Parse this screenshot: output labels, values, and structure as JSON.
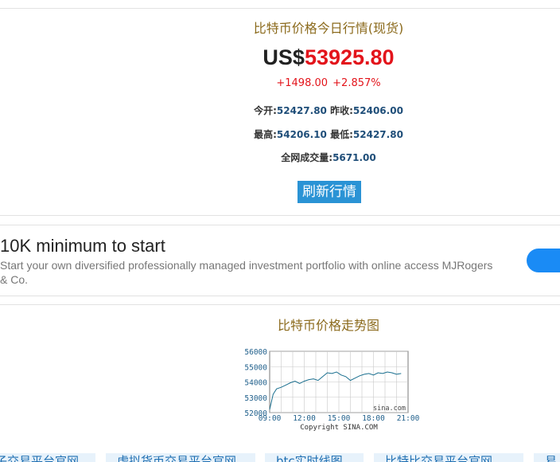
{
  "header": {
    "title": "比特币价格今日行情(现货)"
  },
  "price": {
    "currency": "US$",
    "value": "53925.80",
    "change": "+1498.00",
    "change_pct": "+2.857%"
  },
  "stats": {
    "open_label": "今开:",
    "open_value": "52427.80",
    "prev_close_label": "昨收:",
    "prev_close_value": "52406.00",
    "high_label": "最高:",
    "high_value": "54206.10",
    "low_label": "最低:",
    "low_value": "52427.80",
    "volume_label": "全网成交量:",
    "volume_value": "5671.00"
  },
  "refresh_button": "刷新行情",
  "ad": {
    "title": "10K minimum to start",
    "description": "Start your own diversified professionally managed investment portfolio with online access MJRogers & Co."
  },
  "chart_section": {
    "title": "比特币价格走势图"
  },
  "chart_data": {
    "type": "line",
    "y_ticks": [
      "56000",
      "55000",
      "54000",
      "53000",
      "52000"
    ],
    "x_ticks": [
      "09:00",
      "12:00",
      "15:00",
      "18:00",
      "21:00"
    ],
    "ylim": [
      52000,
      56000
    ],
    "xlim": [
      9,
      21
    ],
    "watermark": "sina.com",
    "copyright": "Copyright  SINA.COM",
    "grid": true,
    "series": [
      {
        "color": "#1a6f8f",
        "x": [
          9.0,
          9.3,
          9.6,
          10.0,
          10.4,
          10.8,
          11.2,
          11.6,
          12.0,
          12.4,
          12.8,
          13.2,
          13.6,
          14.0,
          14.4,
          14.8,
          15.2,
          15.6,
          16.0,
          16.4,
          16.8,
          17.2,
          17.6,
          18.0,
          18.4,
          18.8,
          19.2,
          19.6,
          20.0,
          20.4
        ],
        "y": [
          52200,
          53200,
          53550,
          53650,
          53800,
          53950,
          54050,
          53900,
          54050,
          54150,
          54200,
          54100,
          54350,
          54600,
          54550,
          54650,
          54450,
          54350,
          54100,
          54250,
          54400,
          54500,
          54550,
          54450,
          54600,
          54550,
          54650,
          54600,
          54500,
          54550
        ]
      }
    ]
  },
  "link_bar": {
    "items": [
      "子交易平台官网",
      "虚拟货币交易平台官网",
      "btc实时线图",
      "比特比交易平台官网",
      "易"
    ]
  }
}
